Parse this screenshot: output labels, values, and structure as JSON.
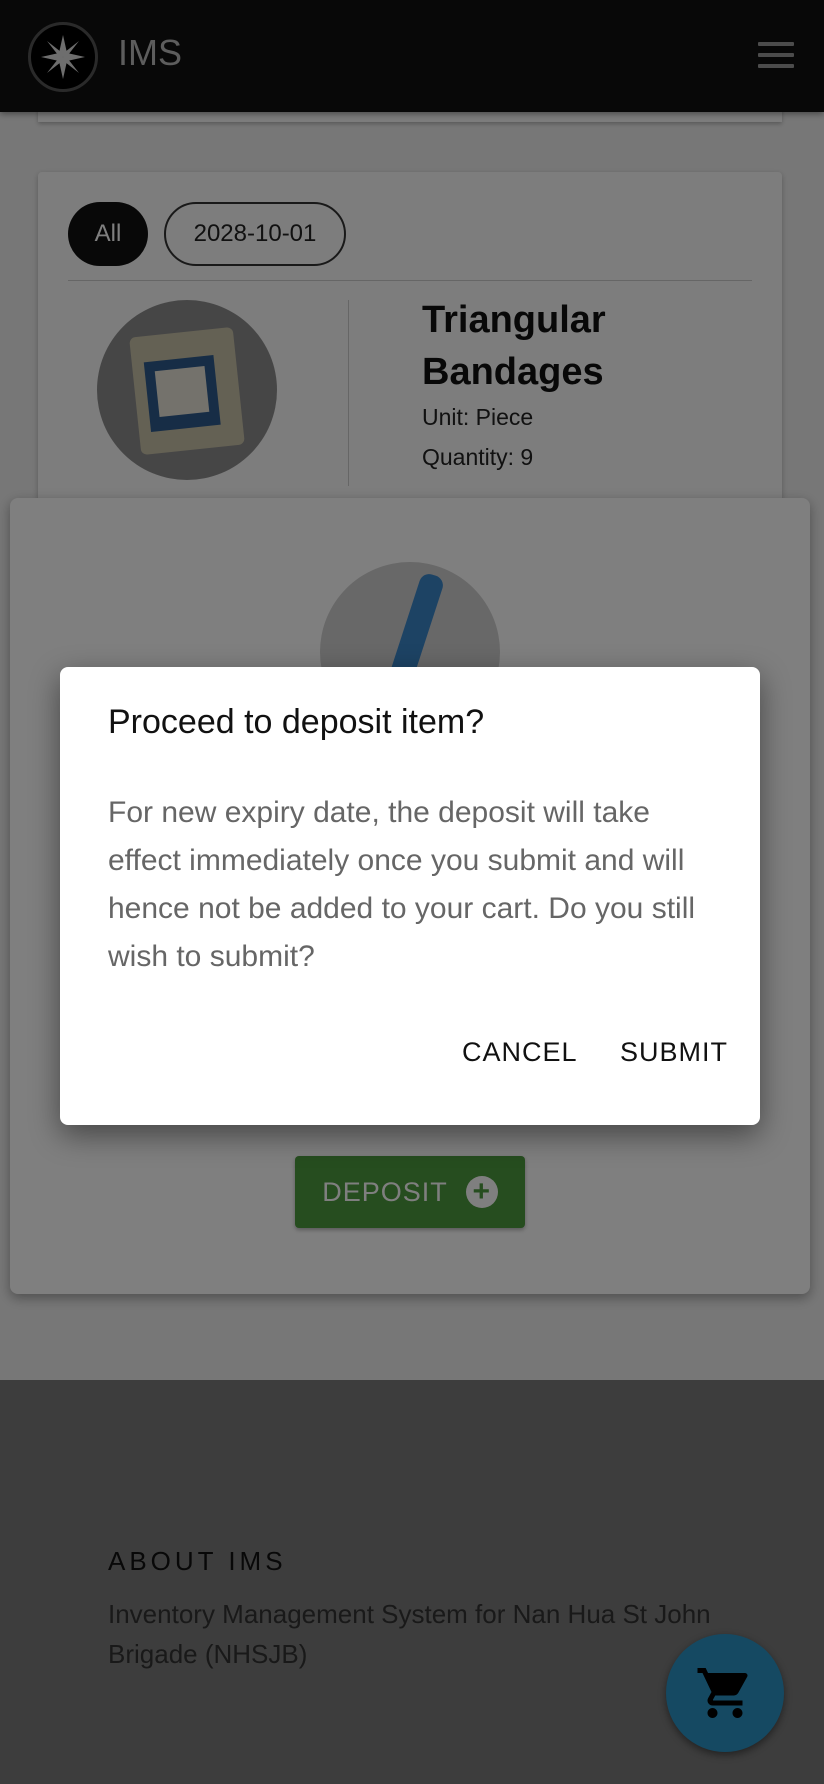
{
  "header": {
    "app_title": "IMS"
  },
  "filters": {
    "all_label": "All",
    "date_label": "2028-10-01"
  },
  "item": {
    "name": "Triangular Bandages",
    "unit": "Unit: Piece",
    "quantity": "Quantity: 9"
  },
  "panel": {
    "deposit_label": "DEPOSIT"
  },
  "footer": {
    "about_title": "ABOUT IMS",
    "about_text": "Inventory Management System for Nan Hua St John Brigade (NHSJB)"
  },
  "dialog": {
    "title": "Proceed to deposit item?",
    "body": "For new expiry date, the deposit will take effect immediately once you submit and will hence not be added to your cart. Do you still wish to submit?",
    "cancel_label": "CANCEL",
    "submit_label": "SUBMIT"
  },
  "colors": {
    "deposit_green": "#4d9a3e",
    "cart_blue": "#2b93c5",
    "header": "#111111"
  },
  "icons": {
    "logo": "star-cross-logo",
    "menu": "hamburger-icon",
    "cart": "cart-icon",
    "plus": "plus-circle-icon"
  }
}
